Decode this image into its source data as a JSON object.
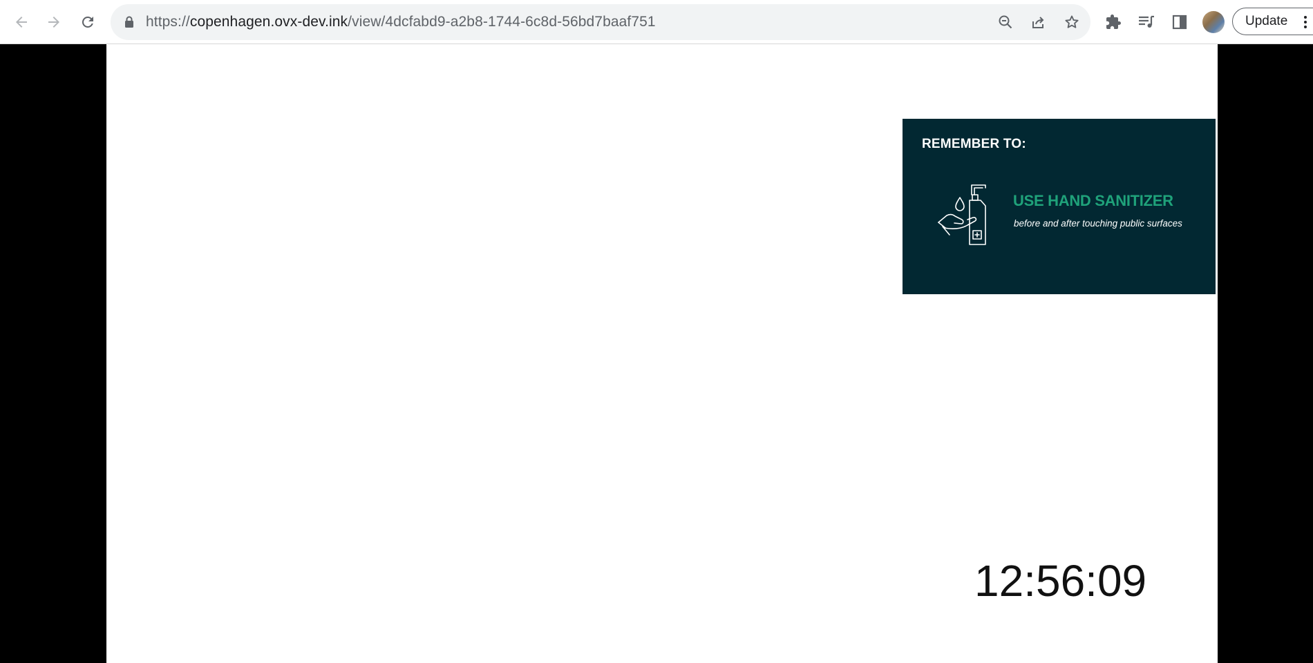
{
  "browser": {
    "url_scheme": "https://",
    "url_host": "copenhagen.ovx-dev.ink",
    "url_path": "/view/4dcfabd9-a2b8-1744-6c8d-56bd7baaf751",
    "update_label": "Update",
    "icons": {
      "back": "back-arrow-icon",
      "forward": "forward-arrow-icon",
      "reload": "reload-icon",
      "lock": "lock-icon",
      "zoom": "zoom-out-icon",
      "share": "share-icon",
      "bookmark": "star-icon",
      "extensions": "puzzle-icon",
      "media": "media-queue-icon",
      "side_panel": "side-panel-icon",
      "menu": "kebab-menu-icon"
    }
  },
  "signage": {
    "notice": {
      "heading": "REMEMBER TO:",
      "title": "USE HAND SANITIZER",
      "subtitle": "before and after touching public surfaces",
      "icon": "hand-sanitizer-icon",
      "colors": {
        "background": "#022832",
        "accent": "#1fa27a",
        "text": "#ffffff"
      }
    },
    "clock": {
      "time": "12:56:09"
    }
  }
}
